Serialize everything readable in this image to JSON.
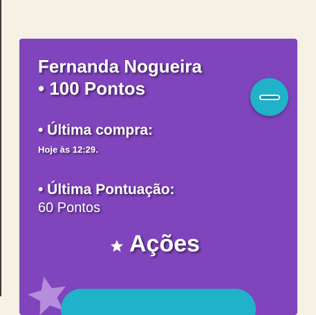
{
  "customer": {
    "name": "Fernanda Nogueira",
    "points": "• 100 Pontos"
  },
  "last_purchase": {
    "heading": "• Última compra:",
    "value": "Hoje às 12:29."
  },
  "last_score": {
    "heading": "• Última Pontuação:",
    "value": "60 Pontos"
  },
  "actions": {
    "title": "Ações",
    "title_icon": "star-icon"
  },
  "collapse_button": {
    "icon": "minus-icon"
  },
  "colors": {
    "background": "#f7f0e4",
    "card": "#8044bd",
    "accent": "#1fb2c9",
    "text": "#ffffff"
  }
}
